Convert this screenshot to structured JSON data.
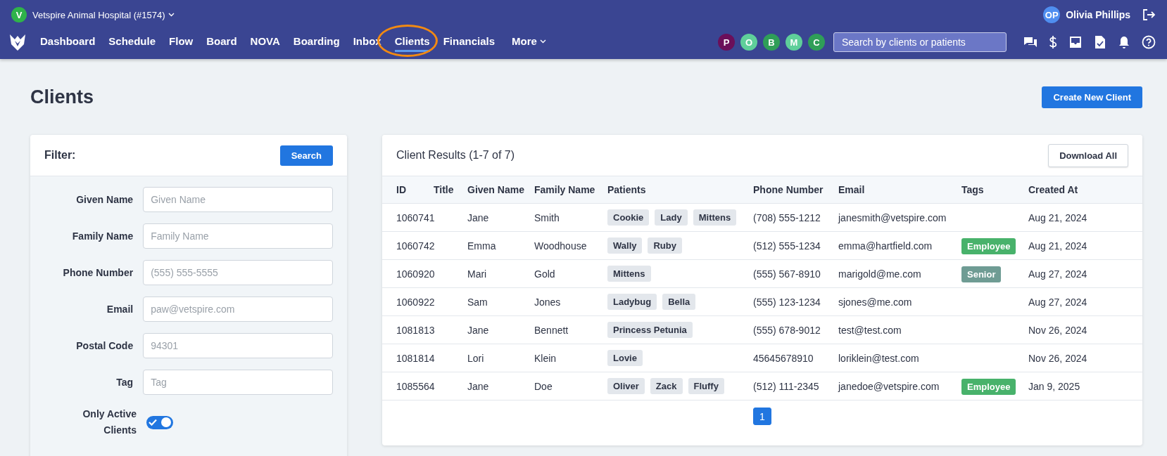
{
  "topbar": {
    "clinic": {
      "avatar": "V",
      "name": "Vetspire Animal Hospital (#1574)"
    },
    "user": {
      "initials": "OP",
      "name": "Olivia Phillips"
    },
    "nav": [
      {
        "label": "Dashboard",
        "selected": false
      },
      {
        "label": "Schedule",
        "selected": false
      },
      {
        "label": "Flow",
        "selected": false
      },
      {
        "label": "Board",
        "selected": false
      },
      {
        "label": "NOVA",
        "selected": false
      },
      {
        "label": "Boarding",
        "selected": false
      },
      {
        "label": "Inbox",
        "selected": false
      },
      {
        "label": "Clients",
        "selected": true
      },
      {
        "label": "Financials",
        "selected": false
      }
    ],
    "more": "More",
    "staff": [
      {
        "initial": "P",
        "color": "#6b0f5a"
      },
      {
        "initial": "O",
        "color": "#5fcf9a"
      },
      {
        "initial": "B",
        "color": "#2f9e58"
      },
      {
        "initial": "M",
        "color": "#5fcf9a"
      },
      {
        "initial": "C",
        "color": "#2f9e58"
      }
    ],
    "search": {
      "placeholder": "Search by clients or patients"
    }
  },
  "page_title": "Clients",
  "create_button": "Create New Client",
  "filter": {
    "title": "Filter:",
    "search_button": "Search",
    "fields": [
      {
        "label": "Given Name",
        "placeholder": "Given Name"
      },
      {
        "label": "Family Name",
        "placeholder": "Family Name"
      },
      {
        "label": "Phone Number",
        "placeholder": "(555) 555-5555"
      },
      {
        "label": "Email",
        "placeholder": "paw@vetspire.com"
      },
      {
        "label": "Postal Code",
        "placeholder": "94301"
      },
      {
        "label": "Tag",
        "placeholder": "Tag"
      }
    ],
    "toggle": {
      "label": "Only Active Clients",
      "on": true
    }
  },
  "results": {
    "title": "Client Results (1-7 of 7)",
    "download_button": "Download All",
    "columns": [
      "ID",
      "Title",
      "Given Name",
      "Family Name",
      "Patients",
      "Phone Number",
      "Email",
      "Tags",
      "Created At"
    ],
    "rows": [
      {
        "id": "1060741",
        "given": "Jane",
        "family": "Smith",
        "patients": [
          "Cookie",
          "Lady",
          "Mittens"
        ],
        "phone": "(708) 555-1212",
        "email": "janesmith@vetspire.com",
        "tags": [],
        "created": "Aug 21, 2024"
      },
      {
        "id": "1060742",
        "given": "Emma",
        "family": "Woodhouse",
        "patients": [
          "Wally",
          "Ruby"
        ],
        "phone": "(512) 555-1234",
        "email": "emma@hartfield.com",
        "tags": [
          {
            "label": "Employee",
            "color": "#48b26b"
          }
        ],
        "created": "Aug 21, 2024"
      },
      {
        "id": "1060920",
        "given": "Mari",
        "family": "Gold",
        "patients": [
          "Mittens"
        ],
        "phone": "(555) 567-8910",
        "email": "marigold@me.com",
        "tags": [
          {
            "label": "Senior",
            "color": "#6f9c94"
          }
        ],
        "created": "Aug 27, 2024"
      },
      {
        "id": "1060922",
        "given": "Sam",
        "family": "Jones",
        "patients": [
          "Ladybug",
          "Bella"
        ],
        "phone": "(555) 123-1234",
        "email": "sjones@me.com",
        "tags": [],
        "created": "Aug 27, 2024"
      },
      {
        "id": "1081813",
        "given": "Jane",
        "family": "Bennett",
        "patients": [
          "Princess Petunia"
        ],
        "phone": "(555) 678-9012",
        "email": "test@test.com",
        "tags": [],
        "created": "Nov 26, 2024"
      },
      {
        "id": "1081814",
        "given": "Lori",
        "family": "Klein",
        "patients": [
          "Lovie"
        ],
        "phone": "45645678910",
        "email": "loriklein@test.com",
        "tags": [],
        "created": "Nov 26, 2024"
      },
      {
        "id": "1085564",
        "given": "Jane",
        "family": "Doe",
        "patients": [
          "Oliver",
          "Zack",
          "Fluffy"
        ],
        "phone": "(512) 111-2345",
        "email": "janedoe@vetspire.com",
        "tags": [
          {
            "label": "Employee",
            "color": "#48b26b"
          }
        ],
        "created": "Jan 9, 2025"
      }
    ],
    "pages": [
      {
        "label": "1",
        "selected": true
      }
    ]
  }
}
